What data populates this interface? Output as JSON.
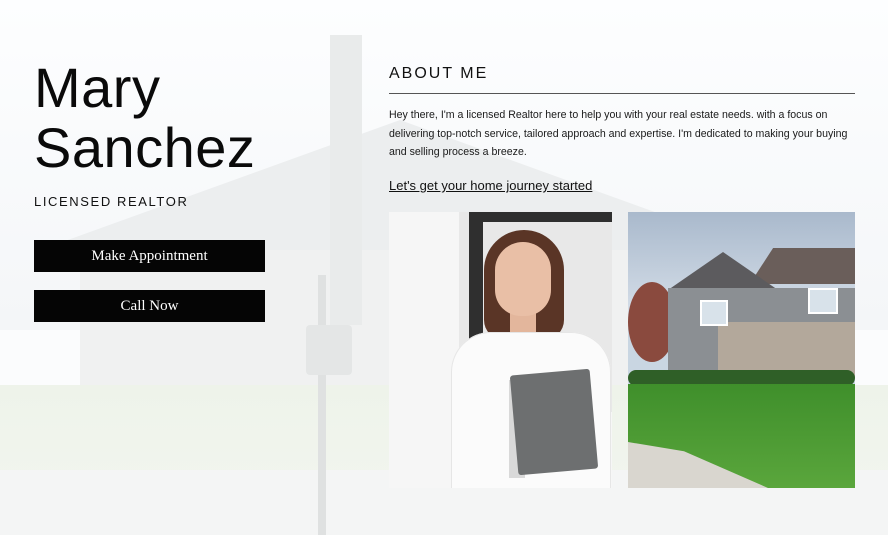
{
  "profile": {
    "first_name": "Mary",
    "last_name": "Sanchez",
    "title": "LICENSED REALTOR"
  },
  "actions": {
    "appointment_label": "Make Appointment",
    "call_label": "Call Now"
  },
  "about": {
    "heading": "ABOUT ME",
    "body": "Hey there, I'm a licensed Realtor here to help you with your real estate needs. with a focus on delivering top-notch service, tailored approach and expertise. I'm dedicated to making your buying and selling process a breeze.",
    "link_text": "Let's get your home journey started"
  },
  "colors": {
    "button_bg": "#050505",
    "button_text": "#ffffff",
    "text": "#111111"
  }
}
